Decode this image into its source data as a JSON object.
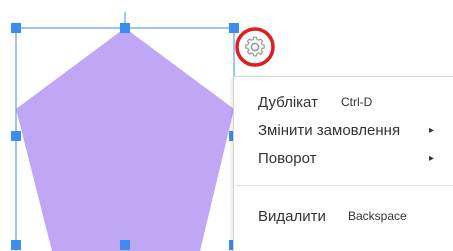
{
  "shape": {
    "type": "pentagon",
    "fill": "#c0a7f5",
    "selection_color": "#3b8df2"
  },
  "settings_button": {
    "icon": "gear-icon",
    "highlight_color": "#e01e1e"
  },
  "context_menu": {
    "items": [
      {
        "label": "Дублікат",
        "shortcut": "Ctrl-D"
      },
      {
        "label": "Змінити замовлення",
        "submenu_arrow": "▸"
      },
      {
        "label": "Поворот",
        "submenu_arrow": "▸"
      },
      {
        "label": "Видалити",
        "shortcut": "Backspace"
      }
    ]
  }
}
